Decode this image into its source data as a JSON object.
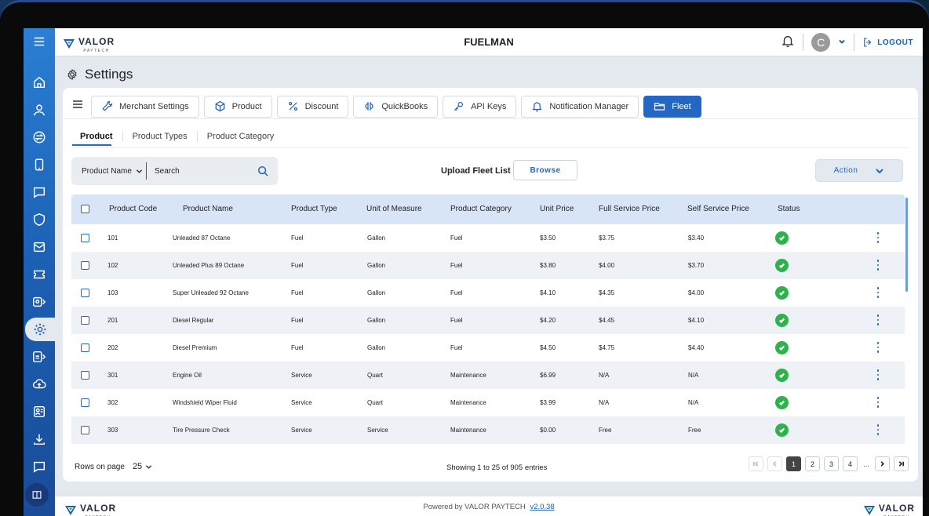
{
  "app": {
    "title": "FUELMAN",
    "brand": "VALOR",
    "brand_sub": "PAYTECH"
  },
  "header": {
    "user_initial": "C",
    "logout_label": "LOGOUT"
  },
  "page": {
    "title": "Settings"
  },
  "tabs": [
    {
      "label": "Merchant Settings",
      "icon": "wrench-icon"
    },
    {
      "label": "Product",
      "icon": "box-icon"
    },
    {
      "label": "Discount",
      "icon": "percent-icon"
    },
    {
      "label": "QuickBooks",
      "icon": "quickbooks-icon"
    },
    {
      "label": "API Keys",
      "icon": "key-icon"
    },
    {
      "label": "Notification Manager",
      "icon": "bell-icon"
    },
    {
      "label": "Fleet",
      "icon": "folder-icon",
      "active": true
    }
  ],
  "subtabs": [
    "Product",
    "Product Types",
    "Product Category"
  ],
  "toolbar": {
    "filter_label": "Product Name",
    "search_placeholder": "Search",
    "upload_label": "Upload Fleet List",
    "browse_label": "Browse",
    "action_label": "Action"
  },
  "table": {
    "columns": [
      "Product Code",
      "Product Name",
      "Product Type",
      "Unit of Measure",
      "Product Category",
      "Unit Price",
      "Full Service Price",
      "Self Service Price",
      "Status"
    ],
    "rows": [
      [
        "101",
        "Unleaded 87 Octane",
        "Fuel",
        "Gallon",
        "Fuel",
        "$3.50",
        "$3.75",
        "$3.40"
      ],
      [
        "102",
        "Unleaded Plus 89 Octane",
        "Fuel",
        "Gallon",
        "Fuel",
        "$3.80",
        "$4.00",
        "$3.70"
      ],
      [
        "103",
        "Super Unleaded 92 Octane",
        "Fuel",
        "Gallon",
        "Fuel",
        "$4.10",
        "$4.35",
        "$4.00"
      ],
      [
        "201",
        "Diesel Regular",
        "Fuel",
        "Gallon",
        "Fuel",
        "$4.20",
        "$4.45",
        "$4.10"
      ],
      [
        "202",
        "Diesel Premium",
        "Fuel",
        "Gallon",
        "Fuel",
        "$4.50",
        "$4.75",
        "$4.40"
      ],
      [
        "301",
        "Engine Oil",
        "Service",
        "Quart",
        "Maintenance",
        "$6.99",
        "N/A",
        "N/A"
      ],
      [
        "302",
        "Windshield Wiper Fluid",
        "Service",
        "Quart",
        "Maintenance",
        "$3.99",
        "N/A",
        "N/A"
      ],
      [
        "303",
        "Tire Pressure Check",
        "Service",
        "Service",
        "Maintenance",
        "$0.00",
        "Free",
        "Free"
      ]
    ]
  },
  "pagination": {
    "rows_label": "Rows on page",
    "rows_value": "25",
    "showing": "Showing 1 to 25 of 905 entries",
    "pages": [
      "1",
      "2",
      "3",
      "4"
    ],
    "ellipsis": "..."
  },
  "footer": {
    "powered": "Powered by VALOR PAYTECH",
    "version": "v2.0.38"
  },
  "colors": {
    "primary": "#2366c4",
    "sidebar": "#1c5fb3",
    "success": "#2db34a",
    "header_row": "#d7e5f7"
  }
}
